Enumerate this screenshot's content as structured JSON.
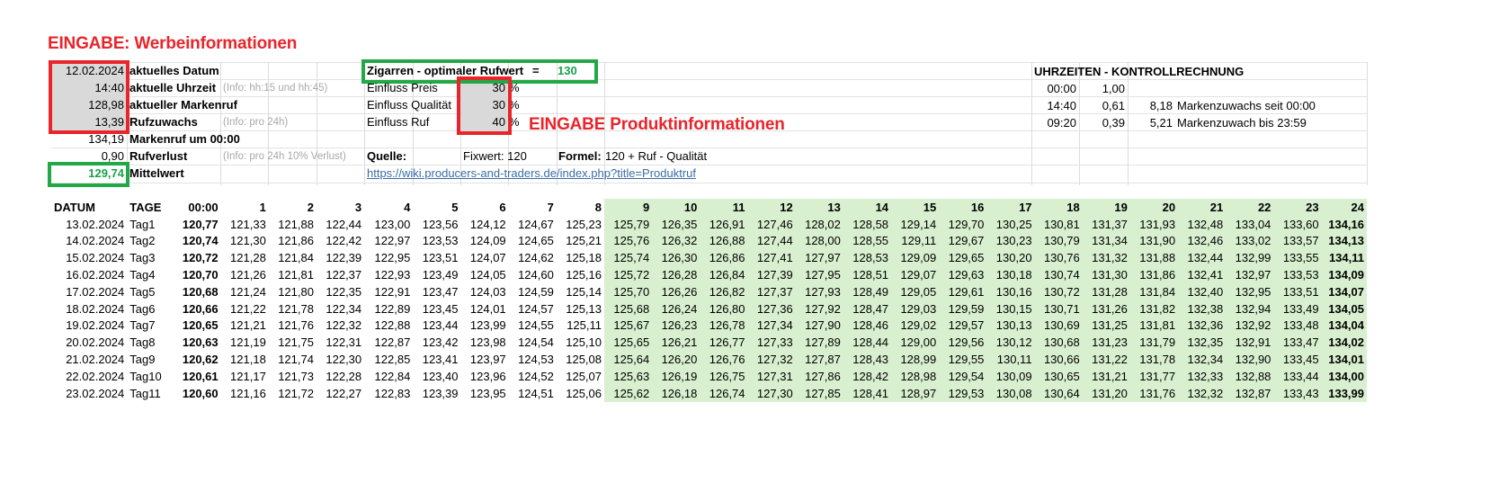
{
  "title_werbe": "EINGABE: Werbeinformationen",
  "title_produkt": "EINGABE Produktinformationen",
  "left": {
    "datum_val": "12.02.2024",
    "datum_label": "aktuelles Datum",
    "uhrzeit_val": "14:40",
    "uhrzeit_label": "aktuelle Uhrzeit",
    "uhrzeit_info": "(Info: hh:15 und hh:45)",
    "markenruf_val": "128,98",
    "markenruf_label": "aktueller Markenruf",
    "rufzuwachs_val": "13,39",
    "rufzuwachs_label": "Rufzuwachs",
    "rufzuwachs_info": "(Info: pro 24h)",
    "markenruf00_val": "134,19",
    "markenruf00_label": "Markenruf um 00:00",
    "rufverlust_val": "0,90",
    "rufverlust_label": "Rufverlust",
    "rufverlust_info": "(Info: pro 24h 10% Verlust)",
    "mittelwert_val": "129,74",
    "mittelwert_label": "Mittelwert"
  },
  "mid": {
    "zigarren_label": "Zigarren - optimaler Rufwert",
    "eq": "=",
    "zigarren_val": "130",
    "preis_label": "Einfluss Preis",
    "preis_val": "30",
    "pct1": "%",
    "qual_label": "Einfluss Qualität",
    "qual_val": "30",
    "pct2": "%",
    "ruf_label": "Einfluss Ruf",
    "ruf_val": "40",
    "pct3": "%",
    "quelle_label": "Quelle:",
    "fixwert": "Fixwert: 120",
    "formel_label": "Formel:",
    "formel_val": "120 + Ruf - Qualität",
    "url": "https://wiki.producers-and-traders.de/index.php?title=Produktruf"
  },
  "right": {
    "title": "UHRZEITEN - KONTROLLRECHNUNG",
    "r1": [
      "00:00",
      "1,00",
      "",
      ""
    ],
    "r2": [
      "14:40",
      "0,61",
      "8,18",
      "Markenzuwachs seit 00:00"
    ],
    "r3": [
      "09:20",
      "0,39",
      "5,21",
      "Markenzuwach bis 23:59"
    ]
  },
  "table": {
    "headers": [
      "DATUM",
      "TAGE",
      "00:00",
      "1",
      "2",
      "3",
      "4",
      "5",
      "6",
      "7",
      "8",
      "9",
      "10",
      "11",
      "12",
      "13",
      "14",
      "15",
      "16",
      "17",
      "18",
      "19",
      "20",
      "21",
      "22",
      "23",
      "24"
    ],
    "rows": [
      [
        "13.02.2024",
        "Tag1",
        "120,77",
        "121,33",
        "121,88",
        "122,44",
        "123,00",
        "123,56",
        "124,12",
        "124,67",
        "125,23",
        "125,79",
        "126,35",
        "126,91",
        "127,46",
        "128,02",
        "128,58",
        "129,14",
        "129,70",
        "130,25",
        "130,81",
        "131,37",
        "131,93",
        "132,48",
        "133,04",
        "133,60",
        "134,16"
      ],
      [
        "14.02.2024",
        "Tag2",
        "120,74",
        "121,30",
        "121,86",
        "122,42",
        "122,97",
        "123,53",
        "124,09",
        "124,65",
        "125,21",
        "125,76",
        "126,32",
        "126,88",
        "127,44",
        "128,00",
        "128,55",
        "129,11",
        "129,67",
        "130,23",
        "130,79",
        "131,34",
        "131,90",
        "132,46",
        "133,02",
        "133,57",
        "134,13"
      ],
      [
        "15.02.2024",
        "Tag3",
        "120,72",
        "121,28",
        "121,84",
        "122,39",
        "122,95",
        "123,51",
        "124,07",
        "124,62",
        "125,18",
        "125,74",
        "126,30",
        "126,86",
        "127,41",
        "127,97",
        "128,53",
        "129,09",
        "129,65",
        "130,20",
        "130,76",
        "131,32",
        "131,88",
        "132,44",
        "132,99",
        "133,55",
        "134,11"
      ],
      [
        "16.02.2024",
        "Tag4",
        "120,70",
        "121,26",
        "121,81",
        "122,37",
        "122,93",
        "123,49",
        "124,05",
        "124,60",
        "125,16",
        "125,72",
        "126,28",
        "126,84",
        "127,39",
        "127,95",
        "128,51",
        "129,07",
        "129,63",
        "130,18",
        "130,74",
        "131,30",
        "131,86",
        "132,41",
        "132,97",
        "133,53",
        "134,09"
      ],
      [
        "17.02.2024",
        "Tag5",
        "120,68",
        "121,24",
        "121,80",
        "122,35",
        "122,91",
        "123,47",
        "124,03",
        "124,59",
        "125,14",
        "125,70",
        "126,26",
        "126,82",
        "127,37",
        "127,93",
        "128,49",
        "129,05",
        "129,61",
        "130,16",
        "130,72",
        "131,28",
        "131,84",
        "132,40",
        "132,95",
        "133,51",
        "134,07"
      ],
      [
        "18.02.2024",
        "Tag6",
        "120,66",
        "121,22",
        "121,78",
        "122,34",
        "122,89",
        "123,45",
        "124,01",
        "124,57",
        "125,13",
        "125,68",
        "126,24",
        "126,80",
        "127,36",
        "127,92",
        "128,47",
        "129,03",
        "129,59",
        "130,15",
        "130,71",
        "131,26",
        "131,82",
        "132,38",
        "132,94",
        "133,49",
        "134,05"
      ],
      [
        "19.02.2024",
        "Tag7",
        "120,65",
        "121,21",
        "121,76",
        "122,32",
        "122,88",
        "123,44",
        "123,99",
        "124,55",
        "125,11",
        "125,67",
        "126,23",
        "126,78",
        "127,34",
        "127,90",
        "128,46",
        "129,02",
        "129,57",
        "130,13",
        "130,69",
        "131,25",
        "131,81",
        "132,36",
        "132,92",
        "133,48",
        "134,04"
      ],
      [
        "20.02.2024",
        "Tag8",
        "120,63",
        "121,19",
        "121,75",
        "122,31",
        "122,87",
        "123,42",
        "123,98",
        "124,54",
        "125,10",
        "125,65",
        "126,21",
        "126,77",
        "127,33",
        "127,89",
        "128,44",
        "129,00",
        "129,56",
        "130,12",
        "130,68",
        "131,23",
        "131,79",
        "132,35",
        "132,91",
        "133,47",
        "134,02"
      ],
      [
        "21.02.2024",
        "Tag9",
        "120,62",
        "121,18",
        "121,74",
        "122,30",
        "122,85",
        "123,41",
        "123,97",
        "124,53",
        "125,08",
        "125,64",
        "126,20",
        "126,76",
        "127,32",
        "127,87",
        "128,43",
        "128,99",
        "129,55",
        "130,11",
        "130,66",
        "131,22",
        "131,78",
        "132,34",
        "132,90",
        "133,45",
        "134,01"
      ],
      [
        "22.02.2024",
        "Tag10",
        "120,61",
        "121,17",
        "121,73",
        "122,28",
        "122,84",
        "123,40",
        "123,96",
        "124,52",
        "125,07",
        "125,63",
        "126,19",
        "126,75",
        "127,31",
        "127,86",
        "128,42",
        "128,98",
        "129,54",
        "130,09",
        "130,65",
        "131,21",
        "131,77",
        "132,33",
        "132,88",
        "133,44",
        "134,00"
      ],
      [
        "23.02.2024",
        "Tag11",
        "120,60",
        "121,16",
        "121,72",
        "122,27",
        "122,83",
        "123,39",
        "123,95",
        "124,51",
        "125,06",
        "125,62",
        "126,18",
        "126,74",
        "127,30",
        "127,85",
        "128,41",
        "128,97",
        "129,53",
        "130,08",
        "130,64",
        "131,20",
        "131,76",
        "132,32",
        "132,87",
        "133,43",
        "133,99"
      ]
    ]
  }
}
